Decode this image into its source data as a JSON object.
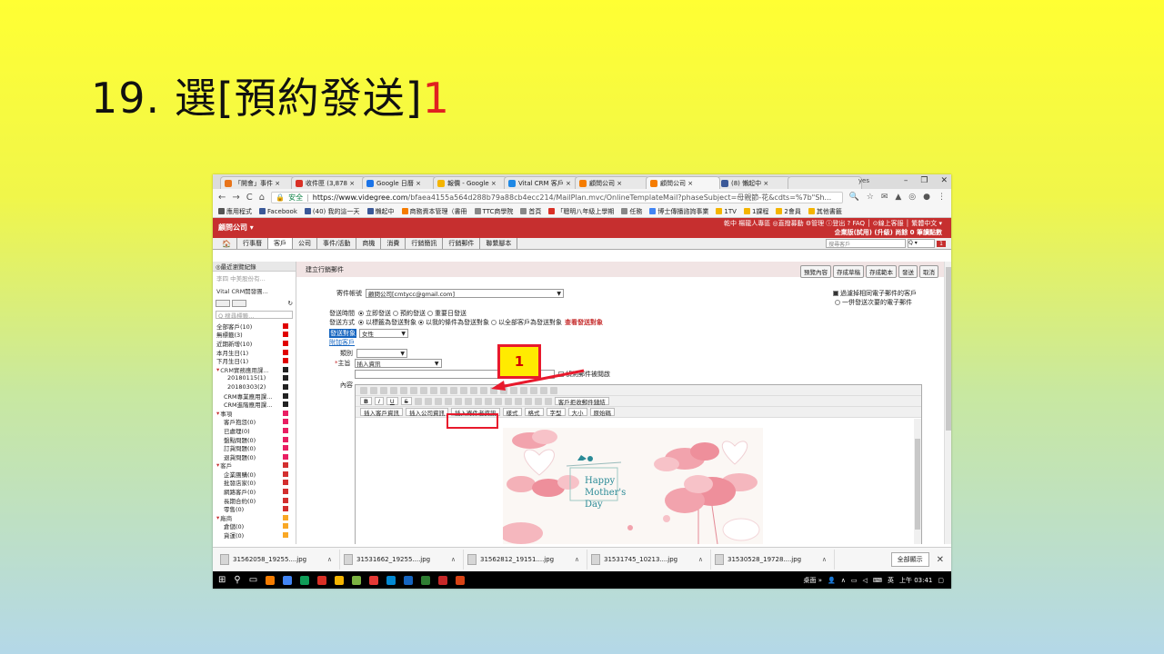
{
  "slide": {
    "title_prefix": "19. 選[預約發送]",
    "title_num": "1"
  },
  "browser": {
    "tabs": [
      {
        "label": "「開會」事件 ×",
        "color": "#e8741a"
      },
      {
        "label": "收件匣 (3,878 ×",
        "color": "#d93025"
      },
      {
        "label": "Google 日曆 ×",
        "color": "#1a73e8"
      },
      {
        "label": "報價 - Google ×",
        "color": "#f4b400"
      },
      {
        "label": "Vital CRM 客戶 ×",
        "color": "#1e88e5"
      },
      {
        "label": "顧問公司 ×",
        "color": "#f57c00"
      },
      {
        "label": "顧問公司 ×",
        "color": "#f57c00"
      },
      {
        "label": "(8) 懶起中 ×",
        "color": "#3b5998"
      }
    ],
    "user": "yes",
    "url_secure": "安全",
    "url_host": "https://www.videgree.com",
    "url_path": "/bfaea4155a564d288b79a88cb4ecc214/MailPlan.mvc/OnlineTemplateMail?phaseSubject=母親節-花&cdts=%7b\"Sh...",
    "bookmarks": [
      {
        "label": "應用程式",
        "color": "#555"
      },
      {
        "label": "Facebook",
        "color": "#3b5998"
      },
      {
        "label": "(40) 我的這一天",
        "color": "#3b5998"
      },
      {
        "label": "懶起中",
        "color": "#3b5998"
      },
      {
        "label": "商務資本管理（書冊",
        "color": "#f57c00"
      },
      {
        "label": "TTC商學院",
        "color": "#888"
      },
      {
        "label": "首頁",
        "color": "#888"
      },
      {
        "label": "「聰明八年級上學期",
        "color": "#d93025"
      },
      {
        "label": "任務",
        "color": "#888"
      },
      {
        "label": "博士傳播諮詢事業",
        "color": "#4285f4"
      },
      {
        "label": "1TV",
        "color": "#f4b400"
      },
      {
        "label": "1課程",
        "color": "#f4b400"
      },
      {
        "label": "2會員",
        "color": "#f4b400"
      },
      {
        "label": "其他書籤",
        "color": "#f4b400"
      }
    ]
  },
  "app": {
    "brand": "顧問公司 ▾",
    "top_links": "乾中 楊龍人專區 ◎直撥募動 ⚙管理 ⓘ登出 ? FAQ │ ⊙線上客服 │ 繁體中文 ▾",
    "trial": "企業版(試用) (升級) 尚餘 0 筆讀點數",
    "menus": [
      "行事曆",
      "客戶",
      "公司",
      "事件/活動",
      "商機",
      "消費",
      "行銷簡訊",
      "行銷郵件",
      "聯繫腳本"
    ],
    "search_placeholder": "搜尋客戶",
    "search_badge": "1"
  },
  "sidebar": {
    "header": "◎最近瀏覽紀錄",
    "recent": [
      "李四 中美股份有...",
      "Vital CRM開發團..."
    ],
    "search_placeholder": "Q 搜尋標籤...",
    "items": [
      {
        "label": "全部客戶(10)",
        "color": "#e00000",
        "indent": 0
      },
      {
        "label": "無標籤(3)",
        "color": "#e00000",
        "indent": 0
      },
      {
        "label": "近期新增(10)",
        "color": "#e00000",
        "indent": 0
      },
      {
        "label": "本月生日(1)",
        "color": "#e00000",
        "indent": 0
      },
      {
        "label": "下月生日(1)",
        "color": "#e00000",
        "indent": 0
      },
      {
        "label": "CRM實務應用課...",
        "color": "#222",
        "indent": -1
      },
      {
        "label": "20180115(1)",
        "color": "#222",
        "indent": 2
      },
      {
        "label": "20180303(2)",
        "color": "#222",
        "indent": 2
      },
      {
        "label": "CRM專業應用課...",
        "color": "#222",
        "indent": 1
      },
      {
        "label": "CRM進階應用課...",
        "color": "#222",
        "indent": 1
      },
      {
        "label": "事項",
        "color": "#e91e63",
        "indent": -1
      },
      {
        "label": "客戶抱怨(0)",
        "color": "#e91e63",
        "indent": 1
      },
      {
        "label": "已處理(0)",
        "color": "#e91e63",
        "indent": 1
      },
      {
        "label": "盤點問題(0)",
        "color": "#e91e63",
        "indent": 1
      },
      {
        "label": "訂貨問題(0)",
        "color": "#e91e63",
        "indent": 1
      },
      {
        "label": "退貨問題(0)",
        "color": "#e91e63",
        "indent": 1
      },
      {
        "label": "客戶",
        "color": "#d32f2f",
        "indent": -1
      },
      {
        "label": "企業團購(0)",
        "color": "#d32f2f",
        "indent": 1
      },
      {
        "label": "批發店家(0)",
        "color": "#d32f2f",
        "indent": 1
      },
      {
        "label": "網路客戶(0)",
        "color": "#d32f2f",
        "indent": 1
      },
      {
        "label": "長期合約(0)",
        "color": "#d32f2f",
        "indent": 1
      },
      {
        "label": "零售(0)",
        "color": "#d32f2f",
        "indent": 1
      },
      {
        "label": "廠商",
        "color": "#f9a825",
        "indent": -1
      },
      {
        "label": "倉儲(0)",
        "color": "#f9a825",
        "indent": 1
      },
      {
        "label": "貨運(0)",
        "color": "#f9a825",
        "indent": 1
      }
    ]
  },
  "form": {
    "crumb": "建立行銷郵件",
    "buttons": [
      "預覽內容",
      "存成草稿",
      "存成範本",
      "發送",
      "取消"
    ],
    "sender_label": "寄件帳號",
    "sender_value": "顧問公司[cmtycc@gmail.com]",
    "dedupe_label": "過濾掉相同電子郵件的客戶",
    "all_label": "一併發送次要的電子郵件",
    "time_label": "發送時間",
    "time_options": [
      "立即發送",
      "預約發送",
      "重要日發送"
    ],
    "method_label": "發送方式",
    "method_options": [
      "以標籤為發送對象",
      "以我的條件為發送對象",
      "以全部客戶為發送對象"
    ],
    "view_targets": "查看發送對象",
    "target_label": "發送對象",
    "target_value": "女性",
    "attach_label": "附加客戶",
    "category_label": "類別",
    "subject_label": "主旨",
    "subject_value": "插入資訊",
    "detect_label": "偵測郵件被閱啟",
    "content_label": "內容",
    "toolbar_buttons": [
      "插入客戶資訊",
      "插入公司資訊",
      "插入寄件者資訊",
      "樣式",
      "格式",
      "字型",
      "大小",
      "原始碼"
    ],
    "unsubscribe_btn": "客戶拒收郵件鏈結",
    "card_text_1": "Happy",
    "card_text_2": "Mother's",
    "card_text_3": "Day"
  },
  "annotation": {
    "step": "1"
  },
  "downloads": {
    "items": [
      "31562058_19255....jpg",
      "31531662_19255....jpg",
      "31562812_19151....jpg",
      "31531745_10213....jpg",
      "31530528_19728....jpg"
    ],
    "show_all": "全部顯示"
  },
  "taskbar": {
    "desktop": "桌面 »",
    "time": "上午 03:41",
    "app_colors": [
      "#f57c00",
      "#4285f4",
      "#0f9d58",
      "#d93025",
      "#f4b400",
      "#7cb342",
      "#e53935",
      "#0288d1",
      "#1565c0",
      "#2e7d32",
      "#c62828",
      "#d84315"
    ]
  }
}
